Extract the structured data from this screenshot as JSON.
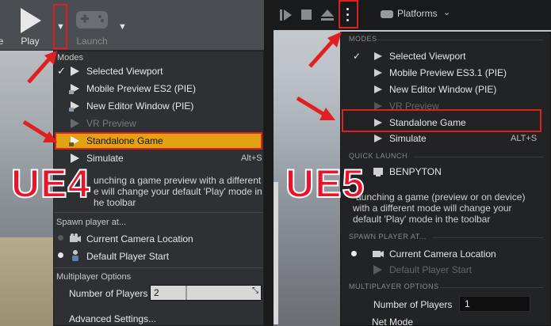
{
  "ue4": {
    "label": "UE4",
    "toolbar": {
      "partial_label": "e",
      "play_label": "Play",
      "launch_label": "Launch"
    },
    "menu": {
      "modes_header": "Modes",
      "modes": [
        {
          "label": "Selected Viewport",
          "checked": true,
          "enabled": true
        },
        {
          "label": "Mobile Preview ES2 (PIE)",
          "enabled": true
        },
        {
          "label": "New Editor Window (PIE)",
          "enabled": true
        },
        {
          "label": "VR Preview",
          "enabled": false
        },
        {
          "label": "Standalone Game",
          "enabled": true,
          "highlighted": true
        },
        {
          "label": "Simulate",
          "shortcut": "Alt+S",
          "enabled": true
        }
      ],
      "description": [
        "unching a game preview with a different",
        "e will change your default 'Play' mode in",
        "he toolbar"
      ],
      "spawn_header": "Spawn player at...",
      "spawn": [
        {
          "label": "Current Camera Location",
          "selected": false
        },
        {
          "label": "Default Player Start",
          "selected": true
        }
      ],
      "multiplayer_header": "Multiplayer Options",
      "num_players_label": "Number of Players",
      "num_players_value": "2",
      "advanced_label": "Advanced Settings..."
    }
  },
  "ue5": {
    "label": "UE5",
    "toolbar": {
      "platforms_label": "Platforms"
    },
    "menu": {
      "modes_header": "MODES",
      "modes": [
        {
          "label": "Selected Viewport",
          "checked": true,
          "enabled": true
        },
        {
          "label": "Mobile Preview ES3.1 (PIE)",
          "enabled": true
        },
        {
          "label": "New Editor Window (PIE)",
          "enabled": true
        },
        {
          "label": "VR Preview",
          "enabled": false
        },
        {
          "label": "Standalone Game",
          "enabled": true,
          "highlighted": true
        },
        {
          "label": "Simulate",
          "shortcut": "ALT+S",
          "enabled": true
        }
      ],
      "quick_launch_header": "QUICK LAUNCH",
      "quick_launch_device": "BENPYTON",
      "description": [
        "aunching a game (preview or on device)",
        "with a different mode will change your",
        "default 'Play' mode in the toolbar"
      ],
      "spawn_header": "SPAWN PLAYER AT...",
      "spawn": [
        {
          "label": "Current Camera Location",
          "selected": true,
          "enabled": true
        },
        {
          "label": "Default Player Start",
          "selected": false,
          "enabled": false
        }
      ],
      "multiplayer_header": "MULTIPLAYER OPTIONS",
      "num_players_label": "Number of Players",
      "num_players_value": "1",
      "net_mode_label": "Net Mode"
    }
  },
  "colors": {
    "annotation_red": "#e02020",
    "ue4_highlight": "#e3a20f"
  }
}
